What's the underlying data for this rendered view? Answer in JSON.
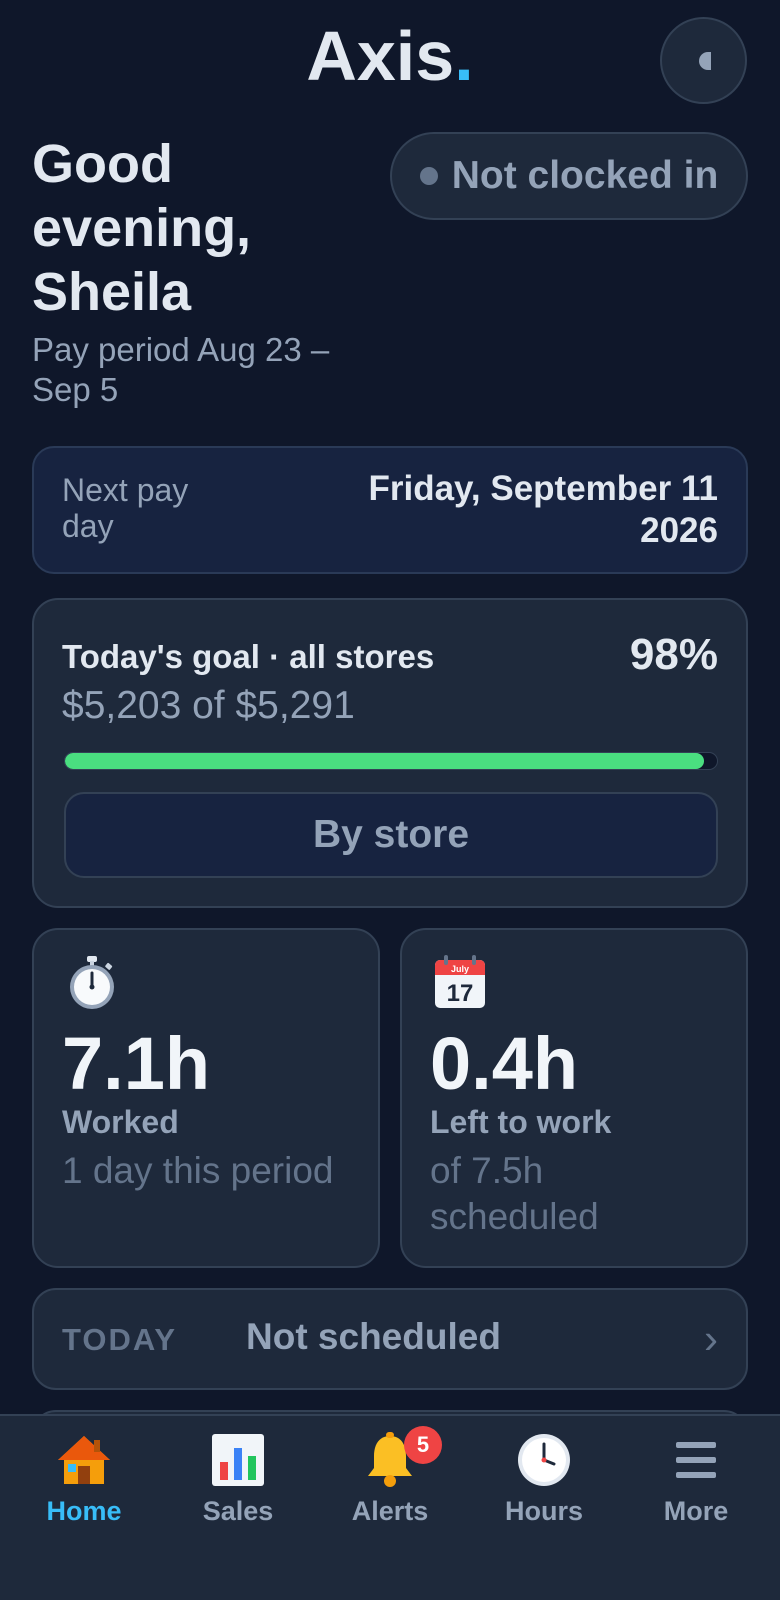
{
  "app": {
    "logo_text": "Axis",
    "logo_dot": ".",
    "accent_color": "#38bdf8",
    "theme_toggle_icon": "moon-icon"
  },
  "greeting": {
    "text": "Good evening, Sheila",
    "pay_period": "Pay period Aug 23 – Sep 5"
  },
  "clock_status": {
    "label": "Not clocked in",
    "dot_color": "#64748b"
  },
  "next_pay_day": {
    "label": "Next pay day",
    "value": "Friday, September 11 2026"
  },
  "goal": {
    "title": "Today's goal · all stores",
    "percent_label": "98%",
    "progress_fraction": 0.98,
    "amount": "$5,203 of $5,291",
    "button_label": "By store",
    "bar_color": "#4ade80"
  },
  "stats": {
    "worked": {
      "icon": "stopwatch-icon",
      "value": "7.1h",
      "label": "Worked",
      "sub": "1 day this period"
    },
    "left": {
      "icon": "calendar-icon",
      "calendar_month": "July",
      "calendar_day": "17",
      "value": "0.4h",
      "label": "Left to work",
      "sub": "of 7.5h scheduled"
    }
  },
  "today": {
    "tag": "TODAY",
    "value": "Not scheduled",
    "chevron": "›"
  },
  "tabbar": {
    "home": {
      "label": "Home",
      "icon": "house-icon"
    },
    "sales": {
      "label": "Sales",
      "icon": "bar-chart-icon"
    },
    "alerts": {
      "label": "Alerts",
      "icon": "bell-icon",
      "badge": "5"
    },
    "hours": {
      "label": "Hours",
      "icon": "clock-icon"
    },
    "more": {
      "label": "More",
      "icon": "menu-icon"
    }
  }
}
